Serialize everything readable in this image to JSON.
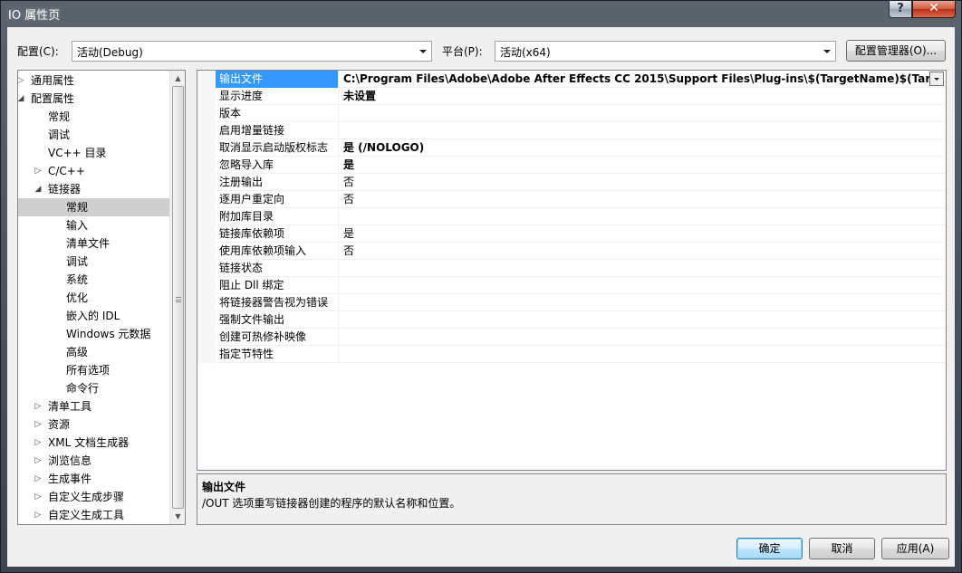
{
  "window": {
    "title": "IO 属性页",
    "help_glyph": "?",
    "close_glyph": "✕"
  },
  "toolbar": {
    "config_label": "配置(C):",
    "config_value": "活动(Debug)",
    "platform_label": "平台(P):",
    "platform_value": "活动(x64)",
    "config_manager_label": "配置管理器(O)..."
  },
  "tree": {
    "items": [
      {
        "label": "通用属性",
        "level": 0,
        "expander": "collapsed"
      },
      {
        "label": "配置属性",
        "level": 0,
        "expander": "expanded"
      },
      {
        "label": "常规",
        "level": 1,
        "expander": "none"
      },
      {
        "label": "调试",
        "level": 1,
        "expander": "none"
      },
      {
        "label": "VC++ 目录",
        "level": 1,
        "expander": "none"
      },
      {
        "label": "C/C++",
        "level": 1,
        "expander": "collapsed"
      },
      {
        "label": "链接器",
        "level": 1,
        "expander": "expanded"
      },
      {
        "label": "常规",
        "level": 2,
        "expander": "none",
        "selected": true
      },
      {
        "label": "输入",
        "level": 2,
        "expander": "none"
      },
      {
        "label": "清单文件",
        "level": 2,
        "expander": "none"
      },
      {
        "label": "调试",
        "level": 2,
        "expander": "none"
      },
      {
        "label": "系统",
        "level": 2,
        "expander": "none"
      },
      {
        "label": "优化",
        "level": 2,
        "expander": "none"
      },
      {
        "label": "嵌入的 IDL",
        "level": 2,
        "expander": "none"
      },
      {
        "label": "Windows 元数据",
        "level": 2,
        "expander": "none"
      },
      {
        "label": "高级",
        "level": 2,
        "expander": "none"
      },
      {
        "label": "所有选项",
        "level": 2,
        "expander": "none"
      },
      {
        "label": "命令行",
        "level": 2,
        "expander": "none"
      },
      {
        "label": "清单工具",
        "level": 1,
        "expander": "collapsed"
      },
      {
        "label": "资源",
        "level": 1,
        "expander": "collapsed"
      },
      {
        "label": "XML 文档生成器",
        "level": 1,
        "expander": "collapsed"
      },
      {
        "label": "浏览信息",
        "level": 1,
        "expander": "collapsed"
      },
      {
        "label": "生成事件",
        "level": 1,
        "expander": "collapsed"
      },
      {
        "label": "自定义生成步骤",
        "level": 1,
        "expander": "collapsed"
      },
      {
        "label": "自定义生成工具",
        "level": 1,
        "expander": "collapsed"
      }
    ]
  },
  "properties": [
    {
      "name": "输出文件",
      "value": "C:\\Program Files\\Adobe\\Adobe After Effects CC 2015\\Support Files\\Plug-ins\\$(TargetName)$(TargetExt)",
      "bold": true,
      "selected": true
    },
    {
      "name": "显示进度",
      "value": "未设置",
      "bold": true
    },
    {
      "name": "版本",
      "value": ""
    },
    {
      "name": "启用增量链接",
      "value": ""
    },
    {
      "name": "取消显示启动版权标志",
      "value": "是 (/NOLOGO)",
      "bold": true
    },
    {
      "name": "忽略导入库",
      "value": "是",
      "bold": true
    },
    {
      "name": "注册输出",
      "value": "否"
    },
    {
      "name": "逐用户重定向",
      "value": "否"
    },
    {
      "name": "附加库目录",
      "value": ""
    },
    {
      "name": "链接库依赖项",
      "value": "是"
    },
    {
      "name": "使用库依赖项输入",
      "value": "否"
    },
    {
      "name": "链接状态",
      "value": ""
    },
    {
      "name": "阻止 Dll 绑定",
      "value": ""
    },
    {
      "name": "将链接器警告视为错误",
      "value": ""
    },
    {
      "name": "强制文件输出",
      "value": ""
    },
    {
      "name": "创建可热修补映像",
      "value": ""
    },
    {
      "name": "指定节特性",
      "value": ""
    }
  ],
  "description": {
    "title": "输出文件",
    "text": "/OUT 选项重写链接器创建的程序的默认名称和位置。"
  },
  "buttons": {
    "ok": "确定",
    "cancel": "取消",
    "apply": "应用(A)"
  },
  "colors": {
    "selection": "#3399ff",
    "tree_selection": "#cfcfcf",
    "close_button": "#c7432a"
  }
}
